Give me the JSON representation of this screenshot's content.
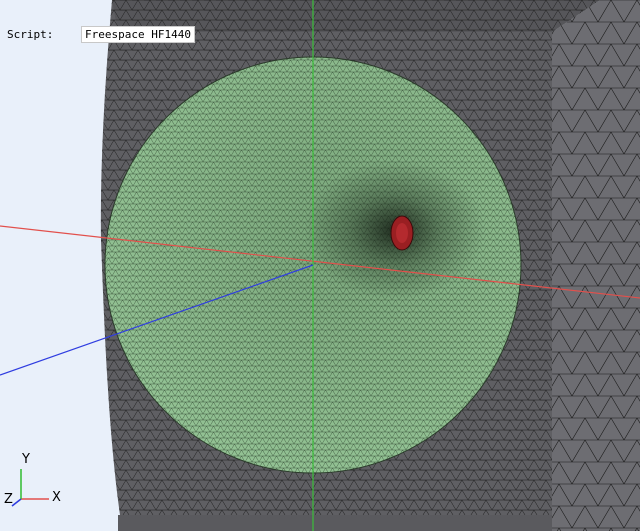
{
  "overlay": {
    "script_label": "Script:",
    "script_value": "Freespace HF1440"
  },
  "triad": {
    "x_label": "X",
    "y_label": "Y",
    "z_label": "Z"
  },
  "colors": {
    "background": "#e9f0fa",
    "mesh_body": "#5f5f63",
    "mesh_side": "#6d6d72",
    "mesh_lines": "#1b1b1b",
    "sphere_fill": "#8bb98c",
    "port": "#9a1f22",
    "axis_x": "#e2504c",
    "axis_y": "#3bbf3b",
    "axis_z": "#2f3de0"
  },
  "icons": {
    "triad": "xyz-axis-triad-icon",
    "port": "excitation-port-icon"
  }
}
